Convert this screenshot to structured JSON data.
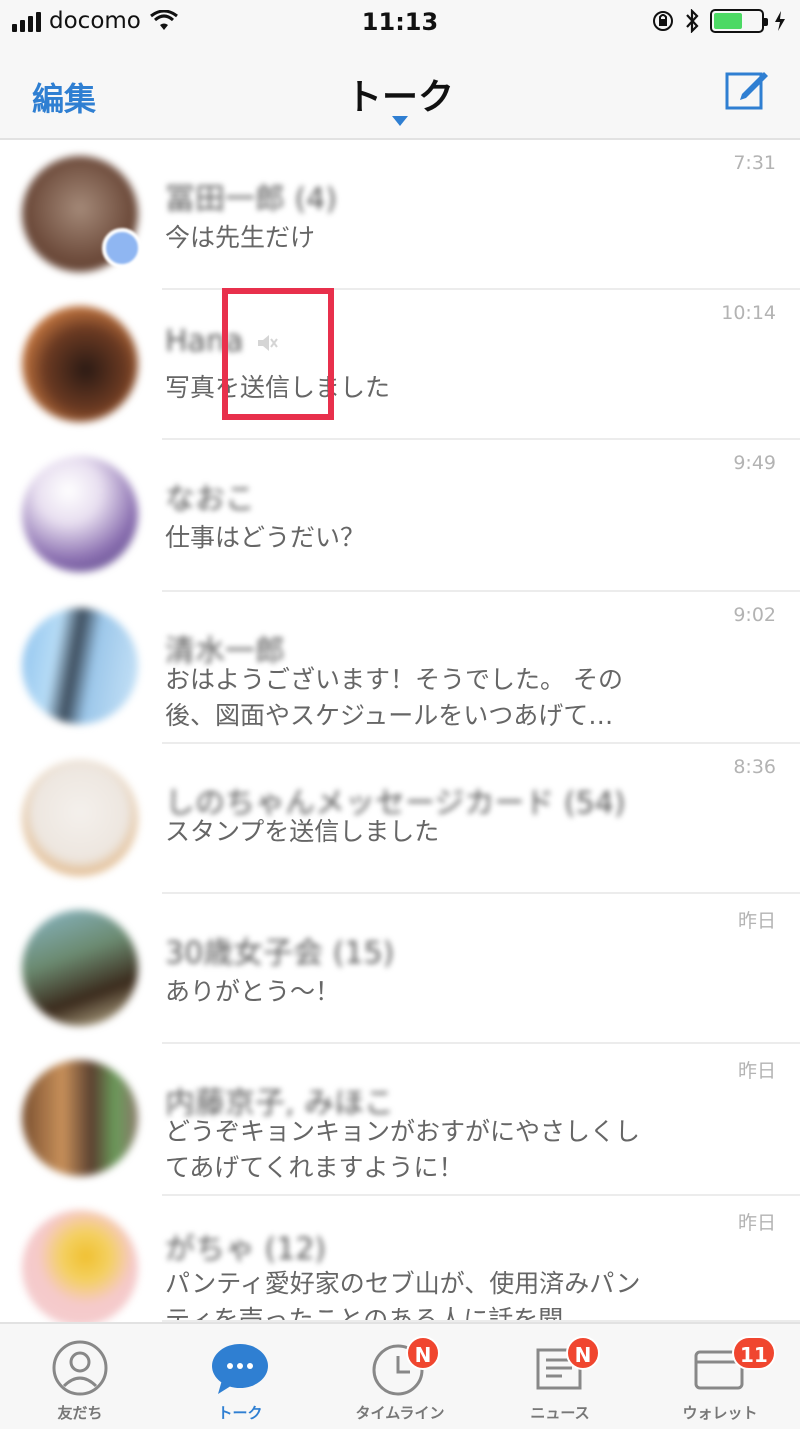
{
  "status_bar": {
    "carrier": "docomo",
    "time": "11:13",
    "battery_level": 0.6
  },
  "nav": {
    "edit_label": "編集",
    "title": "トーク",
    "compose_icon": "compose-icon"
  },
  "chats": [
    {
      "name": "冨田一郎 (4)",
      "time": "7:31",
      "message": "今は先生だけ",
      "blur_name": true
    },
    {
      "name": "Hana",
      "time": "10:14",
      "message": "写真を送信しました",
      "muted": true
    },
    {
      "name": "なおこ",
      "time": "9:49",
      "message": "仕事はどうだい？"
    },
    {
      "name": "清水一郎",
      "time": "9:02",
      "message": "おはようございます！そうでした。 その後、図面やスケジュールをいつあげて…"
    },
    {
      "name": "しのちゃんメッセージカード (54)",
      "time": "8:36",
      "message": "スタンプを送信しました"
    },
    {
      "name": "30歳女子会 (15)",
      "time": "昨日",
      "message": "ありがとう～！"
    },
    {
      "name": "内藤京子, みほこ",
      "time": "昨日",
      "message": "どうぞキョンキョンがおすがにやさしくしてあげてくれますように！"
    },
    {
      "name": "がちゃ (12)",
      "time": "昨日",
      "message": "パンティ愛好家のセブ山が、使用済みパンティを売ったことのある人に話を聞…"
    }
  ],
  "colors": {
    "accent": "#2f7fd2",
    "badge": "#f0462f",
    "highlight": "#e8304c"
  },
  "tabs": [
    {
      "label": "友だち",
      "icon": "friends-icon"
    },
    {
      "label": "トーク",
      "icon": "talk-bubble-icon",
      "active": true
    },
    {
      "label": "タイムライン",
      "icon": "clock-icon",
      "badge": "N"
    },
    {
      "label": "ニュース",
      "icon": "news-icon",
      "badge": "N"
    },
    {
      "label": "ウォレット",
      "icon": "wallet-icon",
      "badge": "11"
    }
  ]
}
